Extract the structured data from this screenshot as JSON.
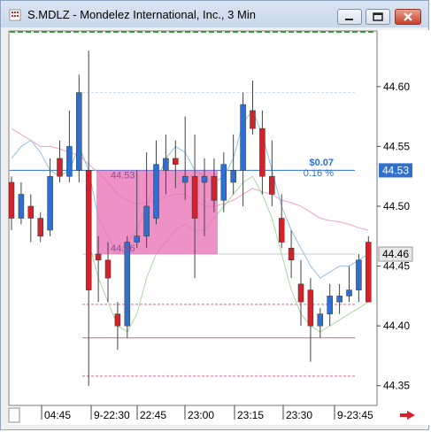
{
  "window": {
    "title": "S.MDLZ - Mondelez International, Inc., 3 Min"
  },
  "icons": {
    "app": "chart-app-icon",
    "minimize": "minimize-icon",
    "maximize": "maximize-icon",
    "close": "close-icon",
    "scroll": "scroll-right-arrow-icon"
  },
  "colors": {
    "up": "#2f6fd0",
    "down": "#d2232a",
    "selection": "#e875b8",
    "price_line": "#2f6fd0",
    "current_price_bg": "#2f6fd0"
  },
  "chart_data": {
    "type": "candlestick",
    "y_ticks": [
      "44.60",
      "44.55",
      "44.50",
      "44.45",
      "44.40",
      "44.35"
    ],
    "x_ticks": [
      "04:45",
      "9-22:30",
      "22:45",
      "23:00",
      "23:15",
      "23:30",
      "9-23:45"
    ],
    "ylim": [
      44.335,
      44.645
    ],
    "price_labels": {
      "current": "44.53",
      "other": "44.46"
    },
    "selection": {
      "top_label": "44.53",
      "bottom_label": "44.46",
      "change": "$0.07",
      "change_pct": "0.16 %"
    },
    "candles": [
      {
        "o": 44.52,
        "h": 44.525,
        "l": 44.48,
        "c": 44.49
      },
      {
        "o": 44.49,
        "h": 44.52,
        "l": 44.485,
        "c": 44.51
      },
      {
        "o": 44.5,
        "h": 44.51,
        "l": 44.47,
        "c": 44.49
      },
      {
        "o": 44.49,
        "h": 44.495,
        "l": 44.47,
        "c": 44.475
      },
      {
        "o": 44.48,
        "h": 44.54,
        "l": 44.475,
        "c": 44.525
      },
      {
        "o": 44.54,
        "h": 44.555,
        "l": 44.52,
        "c": 44.525
      },
      {
        "o": 44.525,
        "h": 44.58,
        "l": 44.52,
        "c": 44.55
      },
      {
        "o": 44.53,
        "h": 44.61,
        "l": 44.52,
        "c": 44.595
      },
      {
        "o": 44.53,
        "h": 44.63,
        "l": 44.35,
        "c": 44.43
      },
      {
        "o": 44.46,
        "h": 44.475,
        "l": 44.42,
        "c": 44.455
      },
      {
        "o": 44.455,
        "h": 44.47,
        "l": 44.42,
        "c": 44.44
      },
      {
        "o": 44.41,
        "h": 44.42,
        "l": 44.38,
        "c": 44.4
      },
      {
        "o": 44.4,
        "h": 44.475,
        "l": 44.39,
        "c": 44.47
      },
      {
        "o": 44.47,
        "h": 44.53,
        "l": 44.465,
        "c": 44.475
      },
      {
        "o": 44.475,
        "h": 44.545,
        "l": 44.465,
        "c": 44.5
      },
      {
        "o": 44.49,
        "h": 44.555,
        "l": 44.485,
        "c": 44.535
      },
      {
        "o": 44.53,
        "h": 44.56,
        "l": 44.51,
        "c": 44.54
      },
      {
        "o": 44.54,
        "h": 44.555,
        "l": 44.515,
        "c": 44.535
      },
      {
        "o": 44.52,
        "h": 44.575,
        "l": 44.505,
        "c": 44.525
      },
      {
        "o": 44.525,
        "h": 44.56,
        "l": 44.44,
        "c": 44.49
      },
      {
        "o": 44.52,
        "h": 44.54,
        "l": 44.475,
        "c": 44.525
      },
      {
        "o": 44.525,
        "h": 44.54,
        "l": 44.495,
        "c": 44.505
      },
      {
        "o": 44.505,
        "h": 44.545,
        "l": 44.495,
        "c": 44.535
      },
      {
        "o": 44.52,
        "h": 44.56,
        "l": 44.51,
        "c": 44.53
      },
      {
        "o": 44.53,
        "h": 44.595,
        "l": 44.5,
        "c": 44.585
      },
      {
        "o": 44.58,
        "h": 44.605,
        "l": 44.56,
        "c": 44.565
      },
      {
        "o": 44.565,
        "h": 44.58,
        "l": 44.51,
        "c": 44.525
      },
      {
        "o": 44.525,
        "h": 44.555,
        "l": 44.5,
        "c": 44.51
      },
      {
        "o": 44.49,
        "h": 44.51,
        "l": 44.465,
        "c": 44.47
      },
      {
        "o": 44.465,
        "h": 44.48,
        "l": 44.44,
        "c": 44.455
      },
      {
        "o": 44.435,
        "h": 44.455,
        "l": 44.4,
        "c": 44.42
      },
      {
        "o": 44.43,
        "h": 44.44,
        "l": 44.37,
        "c": 44.4
      },
      {
        "o": 44.4,
        "h": 44.415,
        "l": 44.39,
        "c": 44.41
      },
      {
        "o": 44.41,
        "h": 44.435,
        "l": 44.4,
        "c": 44.425
      },
      {
        "o": 44.42,
        "h": 44.435,
        "l": 44.41,
        "c": 44.425
      },
      {
        "o": 44.425,
        "h": 44.45,
        "l": 44.42,
        "c": 44.43
      },
      {
        "o": 44.43,
        "h": 44.46,
        "l": 44.42,
        "c": 44.455
      },
      {
        "o": 44.47,
        "h": 44.475,
        "l": 44.42,
        "c": 44.42
      }
    ],
    "overlays": {
      "pink_ma": [
        44.565,
        44.56,
        44.555,
        44.55,
        44.55,
        44.548,
        44.545,
        44.543,
        44.535,
        44.528,
        44.52,
        44.51,
        44.505,
        44.502,
        44.503,
        44.505,
        44.508,
        44.51,
        44.51,
        44.505,
        44.5,
        44.5,
        44.502,
        44.505,
        44.51,
        44.515,
        44.512,
        44.51,
        44.505,
        44.503,
        44.5,
        44.495,
        44.49,
        44.488,
        44.487,
        44.485,
        44.482,
        44.48
      ],
      "blue_band": [
        44.54,
        44.55,
        44.555,
        44.545,
        44.53,
        44.525,
        44.53,
        44.55,
        44.53,
        44.49,
        44.475,
        44.46,
        44.47,
        44.48,
        44.5,
        44.52,
        44.54,
        44.55,
        44.545,
        44.53,
        44.525,
        44.52,
        44.525,
        44.54,
        44.57,
        44.58,
        44.56,
        44.53,
        44.5,
        44.48,
        44.465,
        44.45,
        44.44,
        44.445,
        44.45,
        44.45,
        44.455,
        44.46
      ],
      "green_band": [
        null,
        null,
        null,
        null,
        null,
        null,
        null,
        null,
        44.47,
        44.44,
        44.42,
        44.4,
        44.395,
        44.41,
        44.44,
        44.46,
        44.47,
        44.48,
        44.485,
        44.48,
        44.48,
        44.49,
        44.5,
        44.51,
        44.52,
        44.525,
        44.51,
        44.49,
        44.46,
        44.43,
        44.41,
        44.4,
        44.395,
        44.4,
        44.405,
        44.41,
        44.415,
        44.42
      ]
    },
    "horizontal_lines": [
      {
        "value": 44.595,
        "color": "#c3d9f2",
        "style": "dash"
      },
      {
        "value": 44.53,
        "color": "#2f6fd0",
        "style": "solid"
      },
      {
        "value": 44.46,
        "color": "#c8c8c8",
        "style": "solid"
      },
      {
        "value": 44.418,
        "color": "#e85aa6",
        "style": "dash"
      },
      {
        "value": 44.39,
        "color": "#e85aa6",
        "style": "solid"
      },
      {
        "value": 44.358,
        "color": "#e85aa6",
        "style": "dash"
      }
    ]
  }
}
